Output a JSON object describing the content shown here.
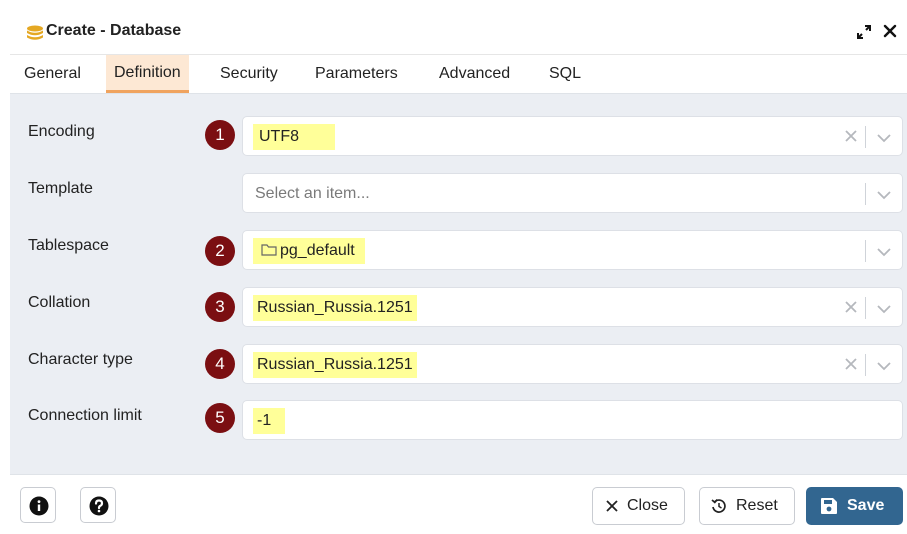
{
  "window": {
    "title": "Create - Database",
    "title_icon": "database-icon",
    "expand_icon": "expand-icon",
    "close_icon": "close-icon"
  },
  "tabs": [
    {
      "label": "General",
      "active": false
    },
    {
      "label": "Definition",
      "active": true
    },
    {
      "label": "Security",
      "active": false
    },
    {
      "label": "Parameters",
      "active": false
    },
    {
      "label": "Advanced",
      "active": false
    },
    {
      "label": "SQL",
      "active": false
    }
  ],
  "fields": {
    "encoding": {
      "label": "Encoding",
      "badge": "1",
      "value": "UTF8"
    },
    "template": {
      "label": "Template",
      "placeholder": "Select an item..."
    },
    "tablespace": {
      "label": "Tablespace",
      "badge": "2",
      "value": "pg_default",
      "icon": "folder-icon"
    },
    "collation": {
      "label": "Collation",
      "badge": "3",
      "value": "Russian_Russia.1251"
    },
    "character_type": {
      "label": "Character type",
      "badge": "4",
      "value": "Russian_Russia.1251"
    },
    "connection_limit": {
      "label": "Connection limit",
      "badge": "5",
      "value": "-1"
    }
  },
  "footer": {
    "info_icon": "info-icon",
    "help_icon": "help-icon",
    "close_label": "Close",
    "reset_label": "Reset",
    "save_label": "Save"
  },
  "colors": {
    "badge": "#7b0f12",
    "highlight": "#ffff99",
    "active_tab_bg": "#fde8d4",
    "active_tab_border": "#f0a35e",
    "primary_button": "#326690",
    "panel_bg": "#ebeef3"
  }
}
